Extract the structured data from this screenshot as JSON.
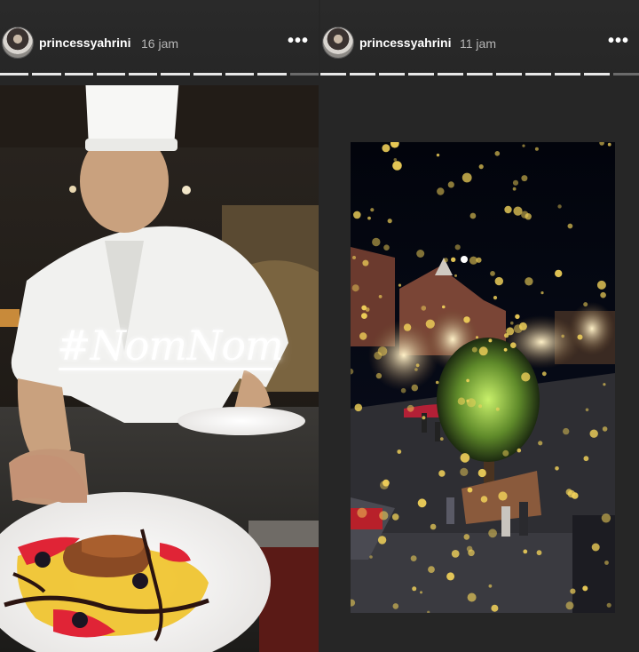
{
  "stories": [
    {
      "username": "princessyahrini",
      "time": "16 jam",
      "more_label": "•••",
      "progress": [
        1,
        1,
        1,
        1,
        1,
        1,
        1,
        1,
        1,
        0
      ],
      "sticker_text": "#NomNom",
      "photo_icon": "chef-plating-food-photo"
    },
    {
      "username": "princessyahrini",
      "time": "11 jam",
      "more_label": "•••",
      "progress": [
        1,
        1,
        1,
        1,
        1,
        1,
        1,
        1,
        1,
        1,
        0
      ],
      "photo_icon": "city-night-lights-photo"
    }
  ],
  "colors": {
    "background": "#262626",
    "progress_active": "#e8e8e8",
    "progress_inactive": "#6b6b6b",
    "sparkle": "#f3d35a"
  }
}
